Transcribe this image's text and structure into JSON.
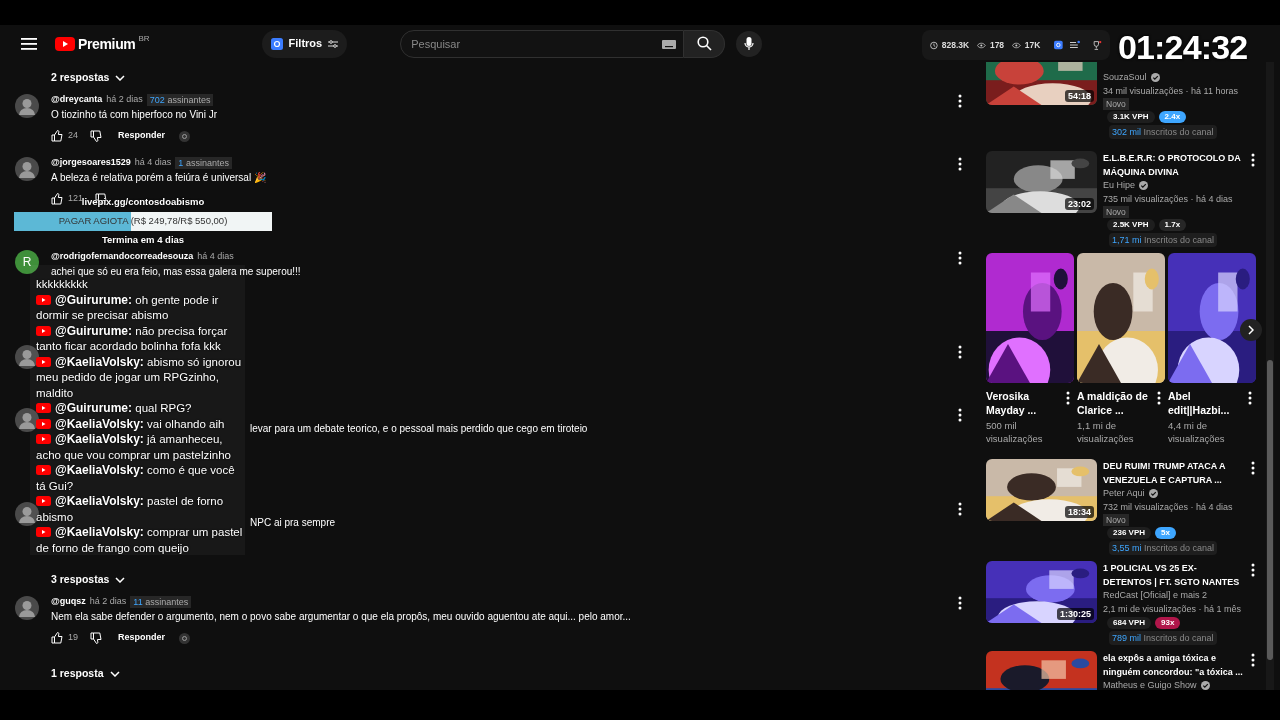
{
  "header": {
    "logo_text": "Premium",
    "region": "BR",
    "filter_label": "Filtros",
    "search_placeholder": "Pesquisar"
  },
  "stream_stats": [
    {
      "kind": "clock",
      "value": "828.3K"
    },
    {
      "kind": "eye",
      "value": "178"
    },
    {
      "kind": "eye",
      "value": "17K"
    }
  ],
  "timer": "01:24:32",
  "comments": [
    {
      "kind": "replies",
      "label": "2 respostas"
    },
    {
      "kind": "comment",
      "author": "@dreycanta",
      "time": "há 2 dias",
      "subscribers": "702",
      "subscribers_label": "assinantes",
      "text": "O tiozinho tá com hiperfoco no Vini Jr",
      "likes": "24",
      "reply_label": "Responder"
    },
    {
      "kind": "comment",
      "author": "@jorgesoares1529",
      "time": "há 4 dias",
      "subscribers": "1",
      "subscribers_label": "assinantes",
      "text": "A beleza é relativa porém a feiúra é universal 🎉",
      "likes": "121"
    },
    {
      "kind": "replies"
    },
    {
      "kind": "comment",
      "avatar_letter": "R",
      "author": "@rodrigofernandocorreadesouza",
      "time": "há 4 dias",
      "text": "achei que só eu era feio, mas essa galera me superou!!!"
    },
    {
      "kind": "replies"
    },
    {
      "kind": "comment",
      "covered": true
    },
    {
      "kind": "comment",
      "covered": true,
      "text": "levar para um debate teorico, e o pessoal mais perdido que cego em tiroteio"
    },
    {
      "kind": "replies"
    },
    {
      "kind": "comment",
      "covered": true,
      "text": "NPC ai pra sempre"
    },
    {
      "kind": "replies",
      "label": "3 respostas"
    },
    {
      "kind": "comment",
      "author": "@guqsz",
      "time": "há 2 dias",
      "subscribers": "11",
      "subscribers_label": "assinantes",
      "text": "Nem ela sabe defender o argumento, nem o povo sabe argumentar o que ela propôs,  meu ouvido aguentou ate aqui... pelo amor...",
      "likes": "19",
      "reply_label": "Responder"
    },
    {
      "kind": "replies",
      "label": "1 resposta"
    }
  ],
  "donation_goal": {
    "link": "livepix.gg/contosdoabismo",
    "label": "PAGAR AGIOTA (R$ 249,78/R$ 550,00)",
    "level": 0.454,
    "deadline": "Termina em 4 dias"
  },
  "live_chat": [
    {
      "text": "kkkkkkkkk"
    },
    {
      "author": "@Guirurume:",
      "text": "oh gente pode ir dormir se precisar abismo"
    },
    {
      "author": "@Guirurume:",
      "text": "não precisa forçar tanto ficar acordado bolinha fofa kkk"
    },
    {
      "author": "@KaeliaVolsky:",
      "text": "abismo só ignorou meu pedido de jogar um RPGzinho, maldito"
    },
    {
      "author": "@Guirurume:",
      "text": "qual RPG?"
    },
    {
      "author": "@KaeliaVolsky:",
      "text": "vai olhando aih"
    },
    {
      "author": "@KaeliaVolsky:",
      "text": "já amanheceu, acho que vou comprar um pastelzinho"
    },
    {
      "author": "@KaeliaVolsky:",
      "text": "como é que você tá Gui?"
    },
    {
      "author": "@KaeliaVolsky:",
      "text": "pastel de forno abismo"
    },
    {
      "author": "@KaeliaVolsky:",
      "text": "comprar um pastel de forno de frango com queijo"
    }
  ],
  "sidebar": [
    {
      "kind": "video",
      "channel": "SouzaSoul",
      "verified": true,
      "meta": "34 mil visualizações · há 11 horas",
      "new_label": "Novo",
      "vph": "3.1K VPH",
      "multiplier": "2.4x",
      "color": "#3ea6ff",
      "subs": "302 mil",
      "subs_label": "Inscritos do canal",
      "duration": "54:18"
    },
    {
      "kind": "video",
      "title": "E.L.B.E.R.R: O PROTOCOLO DA MÁQUINA DIVINA",
      "channel": "Eu Hipe",
      "verified": true,
      "meta": "735 mil visualizações · há 4 dias",
      "new_label": "Novo",
      "vph": "2.5K VPH",
      "multiplier": "1.7x",
      "color": "#272727",
      "subs": "1,71 mi",
      "subs_label": "Inscritos do canal",
      "duration": "23:02"
    },
    {
      "kind": "shorts",
      "items": [
        {
          "title": "Verosika Mayday ...",
          "views": "500 mil visualizações"
        },
        {
          "title": "A maldição de Clarice ...",
          "views": "1,1 mi de visualizações"
        },
        {
          "title": "Abel edit||Hazbi...",
          "views": "4,4 mi de visualizações"
        }
      ]
    },
    {
      "kind": "video",
      "title": "DEU RUIM! TRUMP ATACA A VENEZUELA E CAPTURA ...",
      "channel": "Peter Aqui",
      "verified": true,
      "meta": "732 mil visualizações · há 4 dias",
      "new_label": "Novo",
      "vph": "236 VPH",
      "multiplier": "5x",
      "color": "#3ea6ff",
      "subs": "3,55 mi",
      "subs_label": "Inscritos do canal",
      "duration": "18:34"
    },
    {
      "kind": "video",
      "title": "1 POLICIAL VS 25 EX-DETENTOS | FT. SGTO NANTES",
      "channel": "RedCast [Oficial] e mais 2",
      "verified": false,
      "meta": "2,1 mi de visualizações · há 1 mês",
      "vph": "684 VPH",
      "multiplier": "93x",
      "color": "#b0164a",
      "subs": "789 mil",
      "subs_label": "Inscritos do canal",
      "duration": "1:30:25"
    },
    {
      "kind": "video",
      "title": "ela expôs a amiga tóxica e ninguém concordou: \"a tóxica ...",
      "channel": "Matheus e Guigo Show",
      "verified": true
    }
  ]
}
